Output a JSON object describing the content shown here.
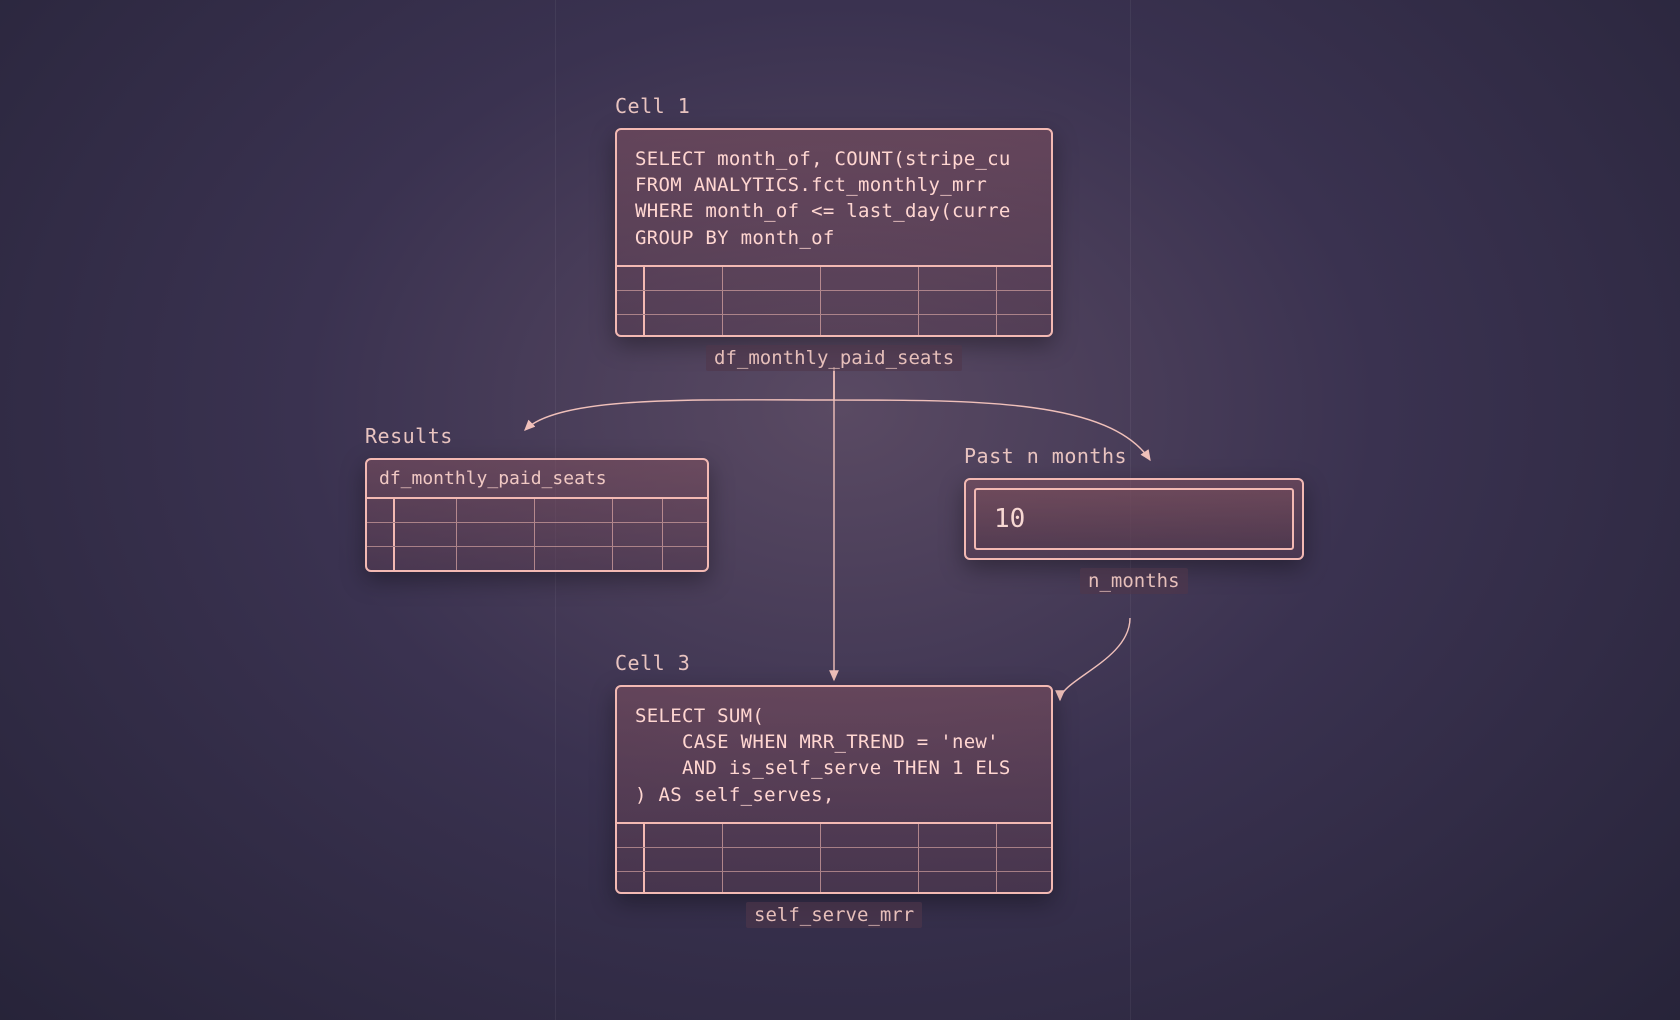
{
  "cell1": {
    "title": "Cell 1",
    "code": "SELECT month_of, COUNT(stripe_cu\nFROM ANALYTICS.fct_monthly_mrr\nWHERE month_of <= last_day(curre\nGROUP BY month_of",
    "output_var": "df_monthly_paid_seats"
  },
  "results": {
    "title": "Results",
    "header": "df_monthly_paid_seats"
  },
  "nmonths": {
    "title": "Past n months",
    "value": "10",
    "output_var": "n_months"
  },
  "cell3": {
    "title": "Cell 3",
    "code": "SELECT SUM(\n    CASE WHEN MRR_TREND = 'new'\n    AND is_self_serve THEN 1 ELS\n) AS self_serves,",
    "output_var": "self_serve_mrr"
  },
  "table_cols": [
    28,
    70,
    90,
    90,
    80,
    80
  ]
}
